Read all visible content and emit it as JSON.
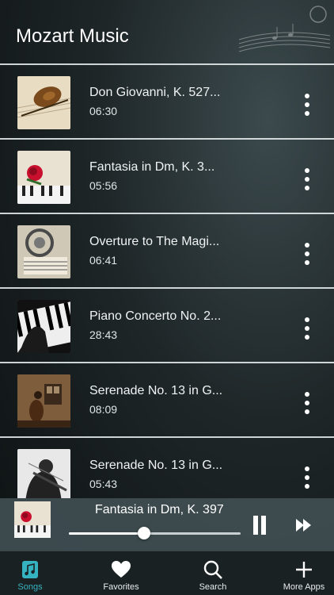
{
  "app": {
    "title": "Mozart Music"
  },
  "songs": [
    {
      "title": "Don Giovanni, K. 527...",
      "duration": "06:30",
      "thumb": "violin-sheet-music"
    },
    {
      "title": "Fantasia in Dm, K. 3...",
      "duration": "05:56",
      "thumb": "rose-piano"
    },
    {
      "title": "Overture to The Magi...",
      "duration": "06:41",
      "thumb": "headphones-sheet-music"
    },
    {
      "title": "Piano Concerto No. 2...",
      "duration": "28:43",
      "thumb": "piano-keys"
    },
    {
      "title": "Serenade No. 13 in G...",
      "duration": "08:09",
      "thumb": "cellist-window"
    },
    {
      "title": "Serenade No. 13 in G...",
      "duration": "05:43",
      "thumb": "violinist"
    }
  ],
  "player": {
    "title": "Fantasia in Dm, K. 397",
    "progress": 0.44,
    "state": "playing"
  },
  "tabs": [
    {
      "label": "Songs",
      "icon": "music-note-icon",
      "active": true
    },
    {
      "label": "Favorites",
      "icon": "heart-icon",
      "active": false
    },
    {
      "label": "Search",
      "icon": "search-icon",
      "active": false
    },
    {
      "label": "More Apps",
      "icon": "plus-icon",
      "active": false
    }
  ],
  "colors": {
    "accent": "#36b3c1",
    "divider": "#e1e8e9",
    "player_bg": "#404e52"
  }
}
